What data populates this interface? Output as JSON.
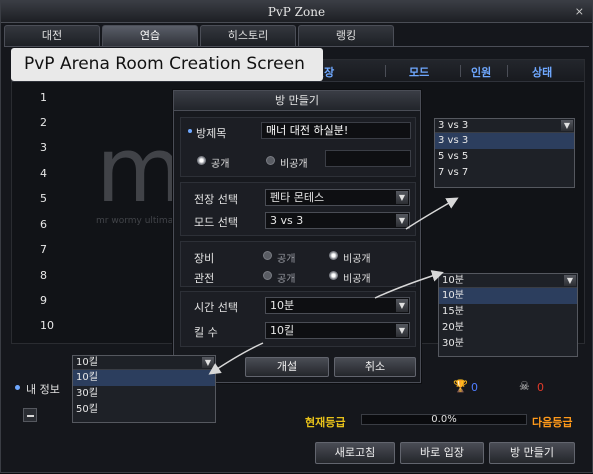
{
  "window": {
    "title": "PvP Zone",
    "close_label": "×"
  },
  "tabs": [
    {
      "label": "대전"
    },
    {
      "label": "연습"
    },
    {
      "label": "히스토리"
    },
    {
      "label": "랭킹"
    }
  ],
  "caption": "PvP Arena Room Creation Screen",
  "list": {
    "headers": {
      "field": "전장",
      "mode": "모드",
      "players": "인원",
      "status": "상태"
    },
    "row_numbers": [
      "1",
      "2",
      "3",
      "4",
      "5",
      "6",
      "7",
      "8",
      "9",
      "10"
    ]
  },
  "dialog": {
    "title": "방 만들기",
    "room_title_label": "방제목",
    "room_title_value": "매너 대전 하실분!",
    "public_label": "공개",
    "private_label": "비공개",
    "field_select_label": "전장 선택",
    "field_select_value": "펜타 몬테스",
    "mode_select_label": "모드 선택",
    "mode_select_value": "3 vs 3",
    "equipment_label": "장비",
    "spectate_label": "관전",
    "equip_public": "공개",
    "equip_private": "비공개",
    "spect_public": "공개",
    "spect_private": "비공개",
    "time_select_label": "시간 선택",
    "time_select_value": "10분",
    "kills_label": "킬 수",
    "kills_value": "10킬",
    "create_button": "개설",
    "cancel_button": "취소"
  },
  "mode_dropdown": {
    "selected": "3 vs 3",
    "options": [
      "3 vs 3",
      "5 vs 5",
      "7 vs 7"
    ]
  },
  "time_dropdown": {
    "selected": "10분",
    "options": [
      "10분",
      "15분",
      "20분",
      "30분"
    ]
  },
  "kills_dropdown": {
    "selected": "10킬",
    "options": [
      "10킬",
      "30킬",
      "50킬"
    ]
  },
  "my_info": {
    "label": "내 정보",
    "wins": "0",
    "losses": "0",
    "current_grade_label": "현재등급",
    "progress_text": "0.0%",
    "progress": 0.0,
    "next_grade_label": "다음등급"
  },
  "bottom_buttons": {
    "refresh": "새로고침",
    "quick_join": "바로 입장",
    "create_room": "방 만들기"
  },
  "colors": {
    "accent_blue": "#6fa8ff",
    "grade_yellow": "#e8c21a",
    "next_grade_orange": "#ff9a1a",
    "wins_blue": "#4f7dff",
    "losses_red": "#e03a2a"
  },
  "watermark": {
    "text_big": "mw",
    "text_small": "mr wormy  ultimate ...s of co..."
  }
}
